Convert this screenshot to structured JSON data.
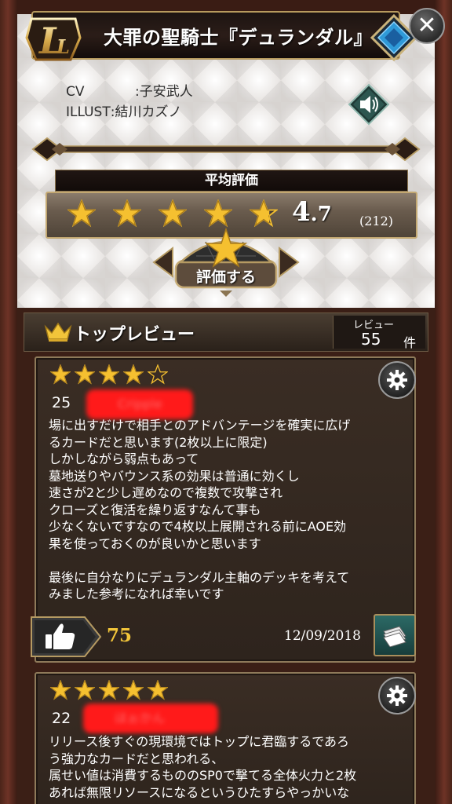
{
  "header": {
    "rarity_icon": "legend-rarity-icon",
    "title": "大罪の聖騎士『デュランダル』",
    "close_label": "✕"
  },
  "credits": {
    "cv_label": "CV",
    "cv_value": ":子安武人",
    "illust_label": "ILLUST",
    "illust_value": ":結川カズノ"
  },
  "rating": {
    "label": "平均評価",
    "value_int": "4",
    "value_dec": ".7",
    "count": "(212)",
    "stars": 4.7,
    "rate_button_label": "評価する"
  },
  "top_reviews": {
    "title": "トップレビュー",
    "count_label": "レビュー",
    "count_value": "55",
    "count_unit": "件"
  },
  "reviews": [
    {
      "stars": 4,
      "rank": "25",
      "author_redacted": "Cripple",
      "body": "場に出すだけで相手とのアドバンテージを確実に広げ\nるカードだと思います(2枚以上に限定)\nしかしながら弱点もあって\n墓地送りやバウンス系の効果は普通に効くし\n速さが2と少し遅めなので複数で攻撃され\nクローズと復活を繰り返すなんて事も\n少なくないですなので4枚以上展開される前にAOE効\n果を使っておくのが良いかと思います\n\n最後に自分なりにデュランダル主軸のデッキを考えて\nみました参考になれば幸いです",
      "likes": "75",
      "date": "12/09/2018"
    },
    {
      "stars": 5,
      "rank": "22",
      "author_redacted": "ほぉかん",
      "body": "リリース後すぐの現環境ではトップに君臨するであろ\nう強力なカードだと思われる、\n属せい値は消費するもののSP0で撃てる全体火力と2枚\nあれば無限リソースになるというひたすらやっかいな"
    }
  ],
  "colors": {
    "star_gold": "#f5c030",
    "like_count": "#f2c53a",
    "redaction": "#ff1a1a"
  }
}
